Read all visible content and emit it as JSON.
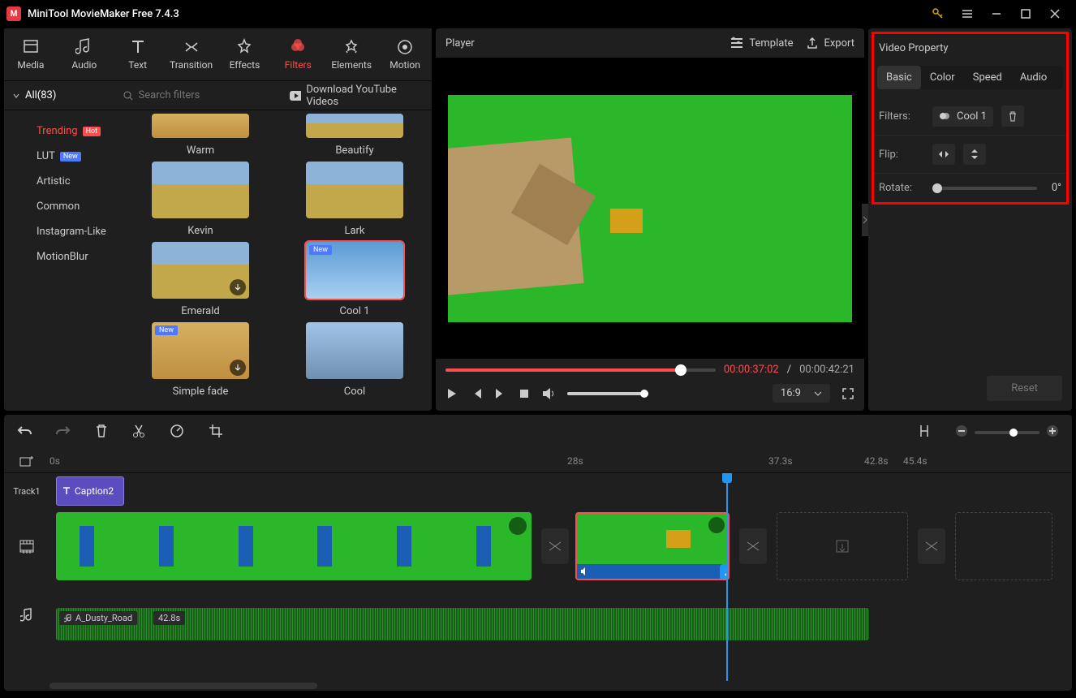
{
  "app": {
    "title": "MiniTool MovieMaker Free 7.4.3"
  },
  "toolbar": [
    {
      "label": "Media"
    },
    {
      "label": "Audio"
    },
    {
      "label": "Text"
    },
    {
      "label": "Transition"
    },
    {
      "label": "Effects"
    },
    {
      "label": "Filters",
      "active": true
    },
    {
      "label": "Elements"
    },
    {
      "label": "Motion"
    }
  ],
  "filterbar": {
    "all": "All(83)",
    "search_placeholder": "Search filters",
    "download": "Download YouTube Videos"
  },
  "categories": [
    {
      "label": "Trending",
      "badge": "Hot",
      "active": true
    },
    {
      "label": "LUT",
      "badge": "New"
    },
    {
      "label": "Artistic"
    },
    {
      "label": "Common"
    },
    {
      "label": "Instagram-Like"
    },
    {
      "label": "MotionBlur"
    }
  ],
  "filters": [
    {
      "name": "Warm",
      "cls": "t-warm",
      "partial": true
    },
    {
      "name": "Beautify",
      "cls": "t-field",
      "partial": true
    },
    {
      "name": "Kevin",
      "cls": "t-field"
    },
    {
      "name": "Lark",
      "cls": "t-field"
    },
    {
      "name": "Emerald",
      "cls": "t-field",
      "dl": true
    },
    {
      "name": "Cool 1",
      "cls": "t-bluesky",
      "new": true,
      "selected": true
    },
    {
      "name": "Simple fade",
      "cls": "t-warm",
      "new": true,
      "dl": true
    },
    {
      "name": "Cool",
      "cls": "t-cool"
    }
  ],
  "player": {
    "label": "Player",
    "template": "Template",
    "export": "Export",
    "current": "00:00:37:02",
    "total": "00:00:42:21",
    "aspect": "16:9"
  },
  "property": {
    "title": "Video Property",
    "tabs": [
      "Basic",
      "Color",
      "Speed",
      "Audio"
    ],
    "active": "Basic",
    "filters_label": "Filters:",
    "filter_value": "Cool 1",
    "flip_label": "Flip:",
    "rotate_label": "Rotate:",
    "rotate_value": "0°",
    "reset": "Reset"
  },
  "timeline": {
    "ruler": [
      "0s",
      "28s",
      "37.3s",
      "42.8s",
      "45.4s"
    ],
    "track1": "Track1",
    "caption": "Caption2",
    "audio_name": "A_Dusty_Road",
    "audio_dur": "42.8s"
  }
}
